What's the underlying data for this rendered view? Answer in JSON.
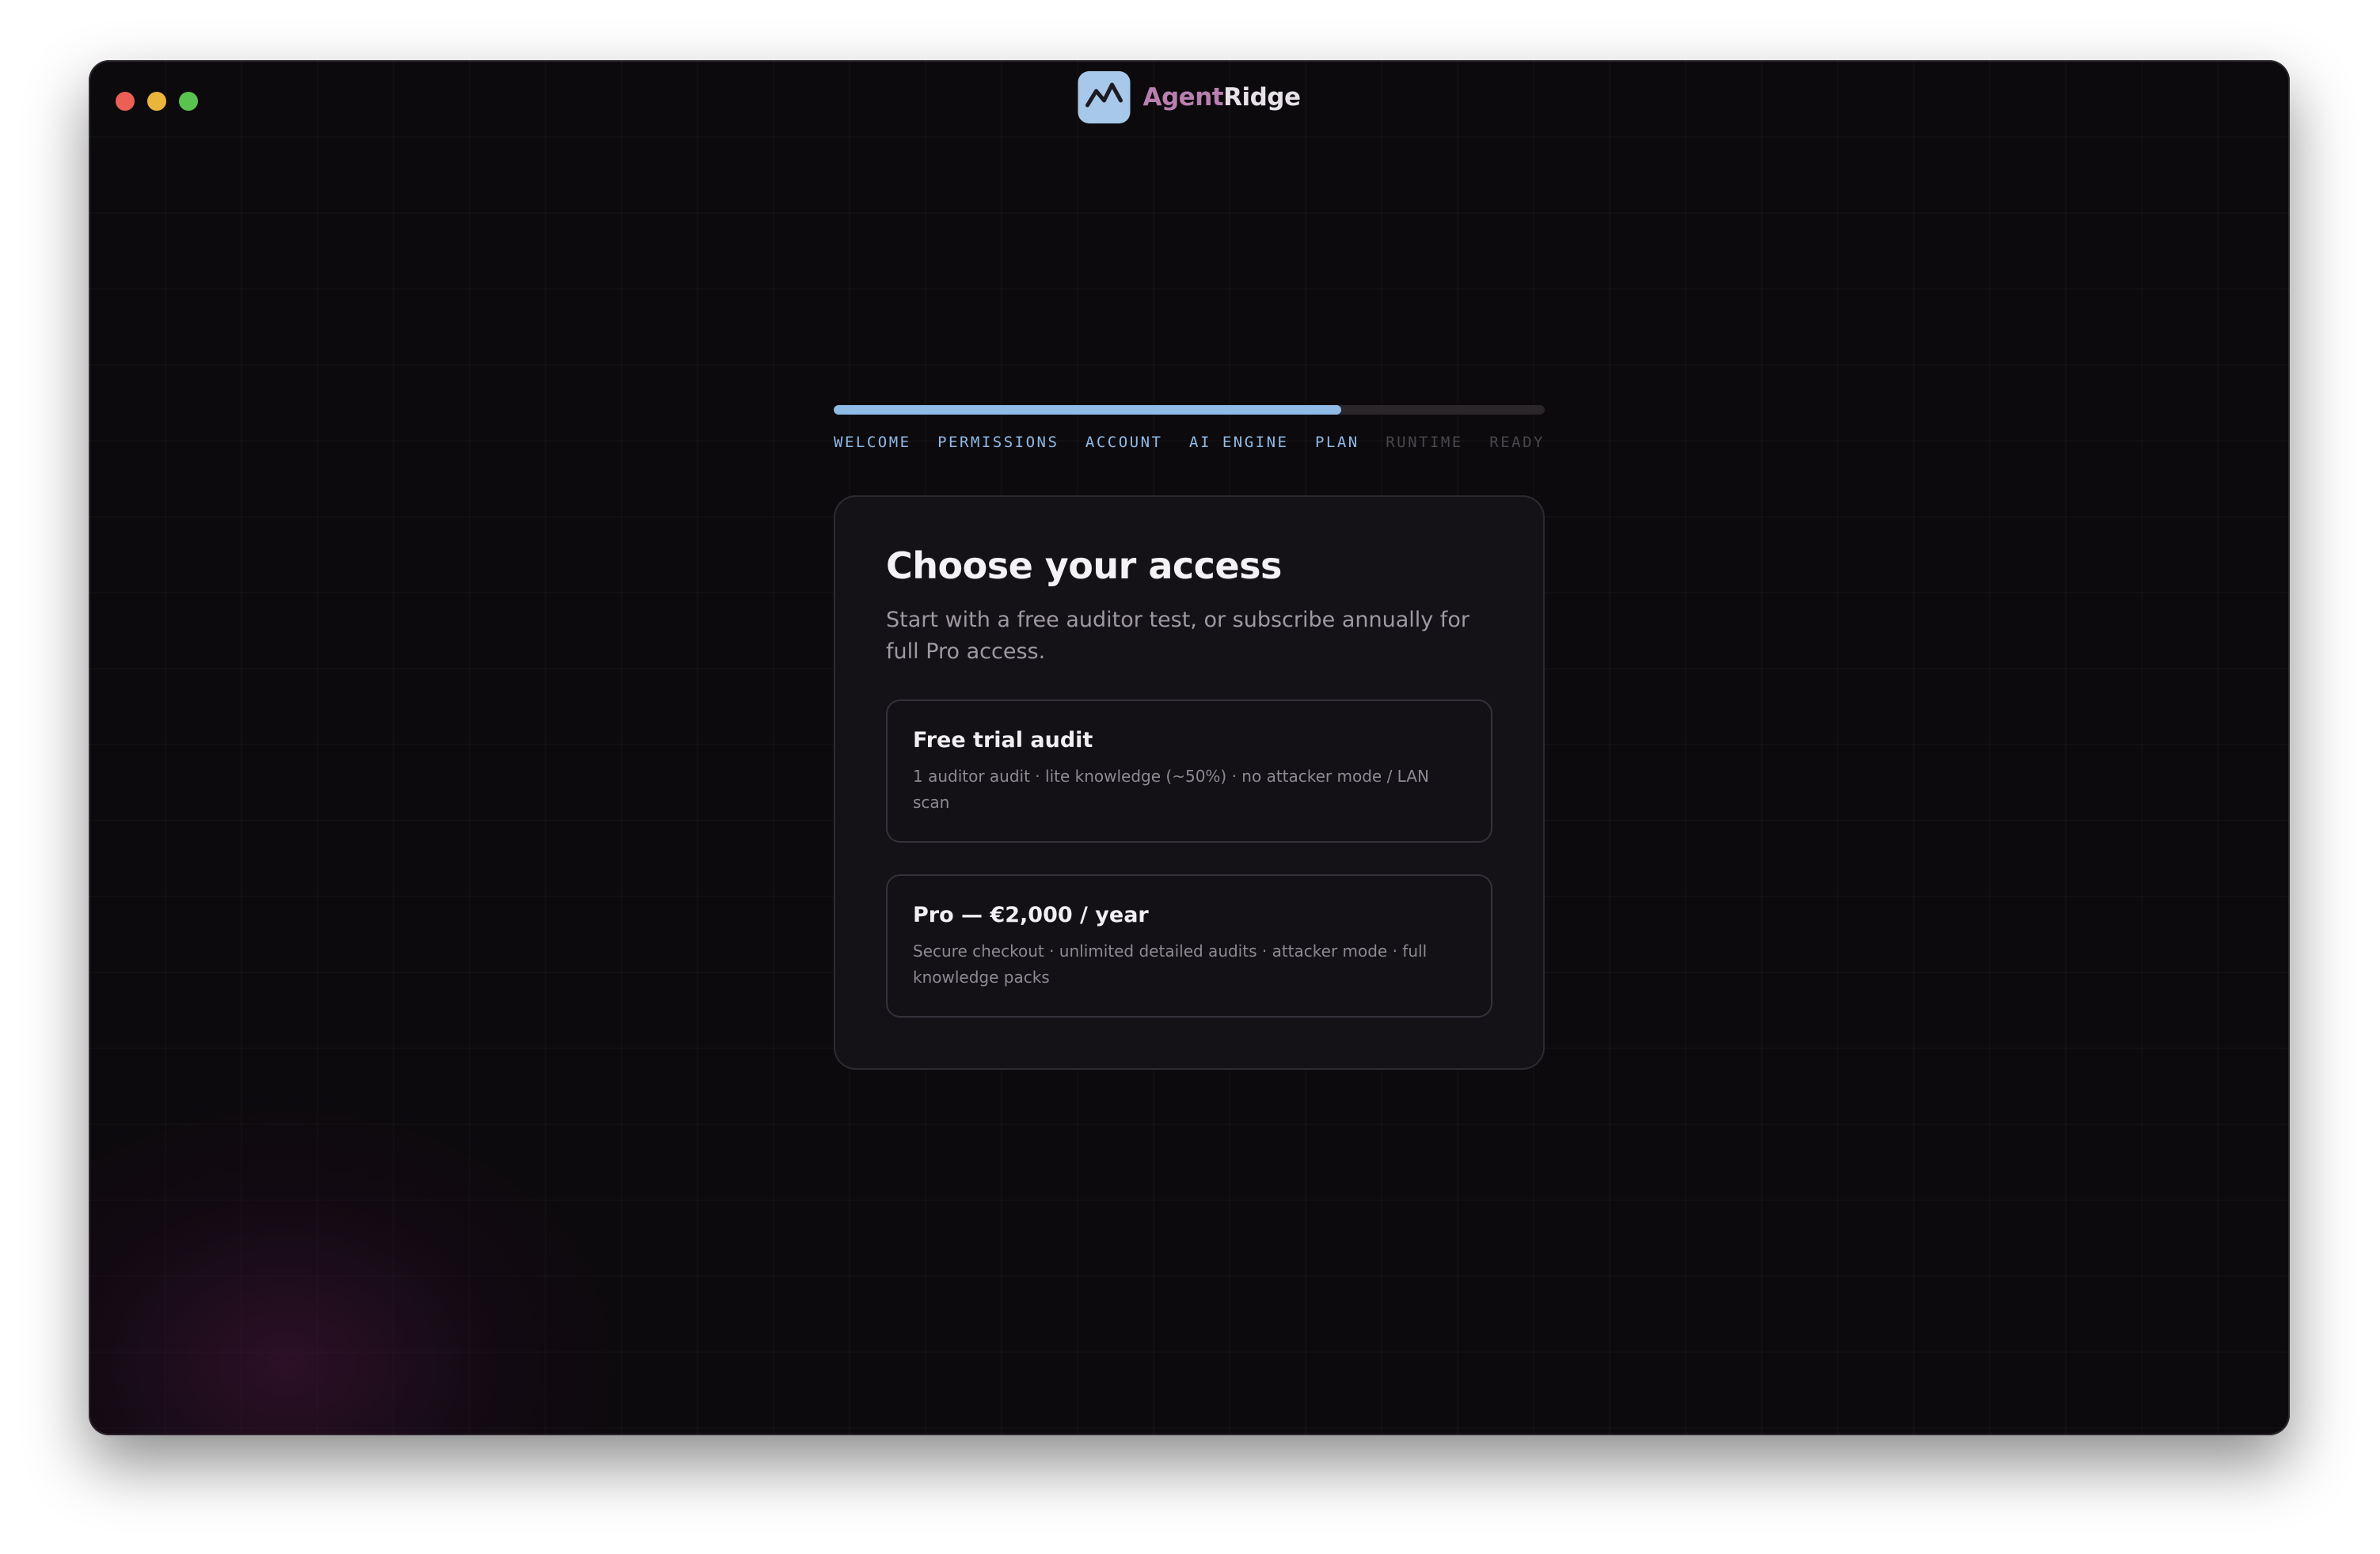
{
  "window": {
    "traffic_lights": [
      {
        "name": "close",
        "color": "#ec5f57"
      },
      {
        "name": "minimize",
        "color": "#e9b53a"
      },
      {
        "name": "zoom",
        "color": "#5ac24e"
      }
    ]
  },
  "brand": {
    "logo_icon": "mountain-peaks-icon",
    "logo_bg": "#a8c8ea",
    "name_part1": "Agent",
    "name_part2": "Ridge",
    "part1_color": "#b97fae",
    "part2_color": "#e6e2e8"
  },
  "progress": {
    "fraction": 0.714,
    "fill_color": "#8fbbe6",
    "steps": [
      {
        "label": "WELCOME",
        "state": "done"
      },
      {
        "label": "PERMISSIONS",
        "state": "done"
      },
      {
        "label": "ACCOUNT",
        "state": "done"
      },
      {
        "label": "AI ENGINE",
        "state": "done"
      },
      {
        "label": "PLAN",
        "state": "current"
      },
      {
        "label": "RUNTIME",
        "state": "upcoming"
      },
      {
        "label": "READY",
        "state": "upcoming"
      }
    ],
    "active_color": "#8fbbe6",
    "inactive_color": "#4a464c"
  },
  "card": {
    "title": "Choose your access",
    "subtitle": "Start with a free auditor test, or subscribe annually for full Pro access.",
    "options": [
      {
        "title": "Free trial audit",
        "description": "1 auditor audit · lite knowledge (~50%) · no attacker mode / LAN scan"
      },
      {
        "title": "Pro — €2,000 / year",
        "description": "Secure checkout · unlimited detailed audits · attacker mode · full knowledge packs"
      }
    ]
  }
}
